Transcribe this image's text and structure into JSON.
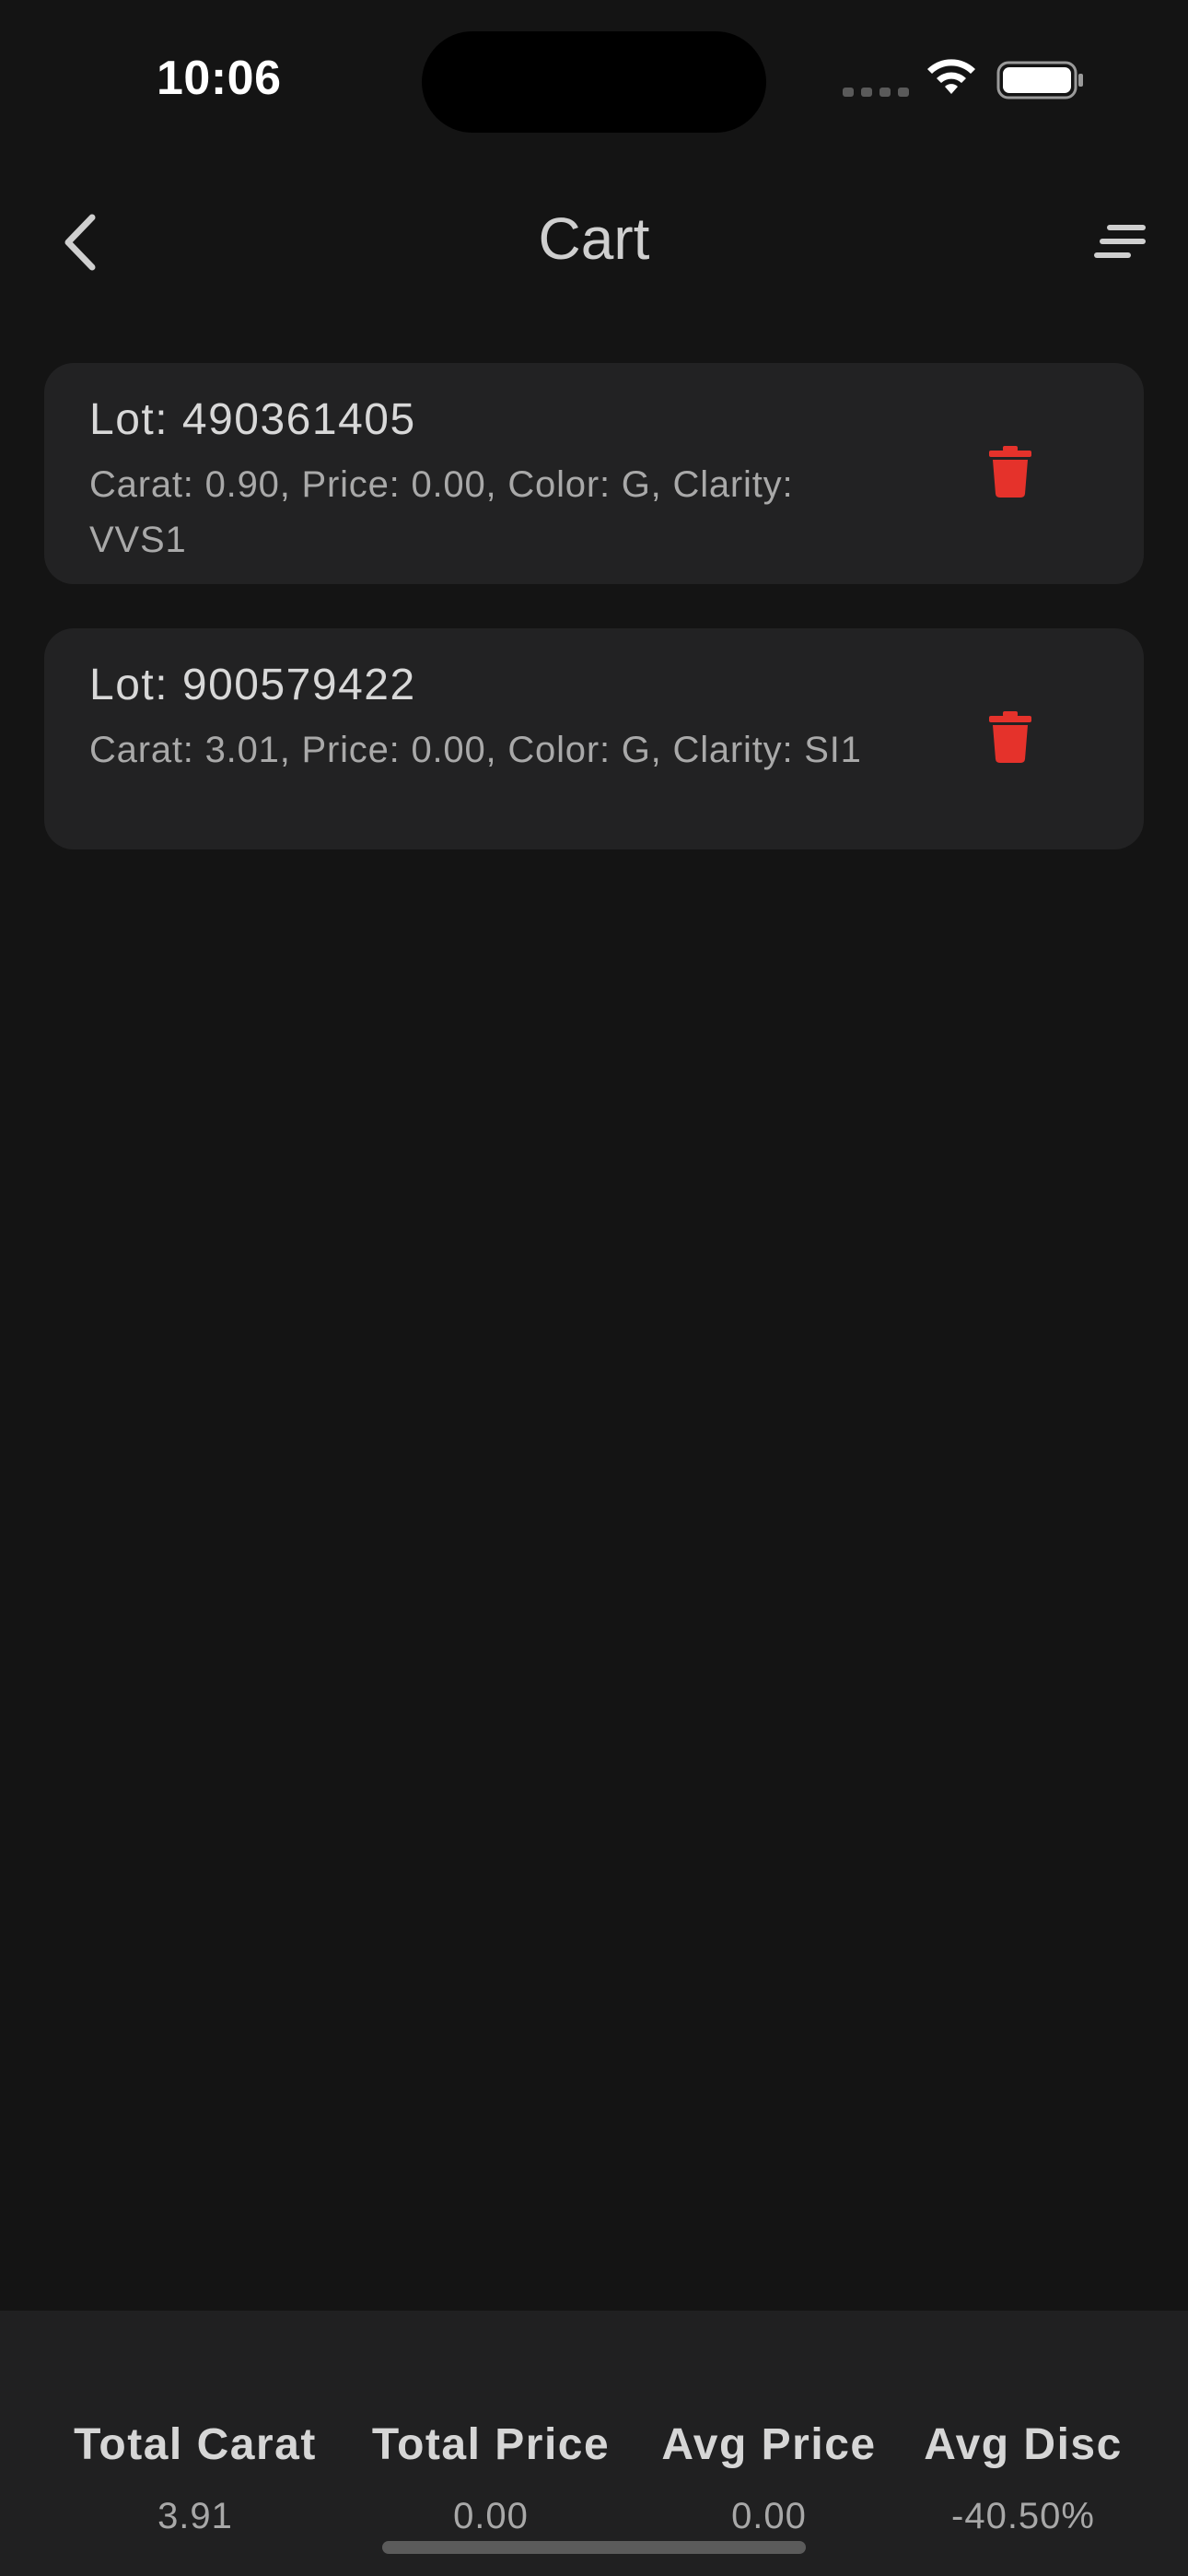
{
  "status_bar": {
    "time": "10:06"
  },
  "nav": {
    "title": "Cart",
    "back_icon": "chevron-left-icon",
    "menu_icon": "sort-lines-icon"
  },
  "cart_items": [
    {
      "lot": "Lot: 490361405",
      "details": "Carat: 0.90, Price: 0.00, Color: G, Clarity: VVS1"
    },
    {
      "lot": "Lot: 900579422",
      "details": "Carat: 3.01, Price: 0.00, Color: G, Clarity: SI1"
    }
  ],
  "totals": {
    "total_carat_label": "Total Carat",
    "total_carat_value": "3.91",
    "total_price_label": "Total Price",
    "total_price_value": "0.00",
    "avg_price_label": "Avg Price",
    "avg_price_value": "0.00",
    "avg_disc_label": "Avg Disc",
    "avg_disc_value": "-40.50%"
  },
  "colors": {
    "background": "#141414",
    "card": "#222223",
    "delete_red": "#e5322b",
    "footer": "#202021"
  }
}
